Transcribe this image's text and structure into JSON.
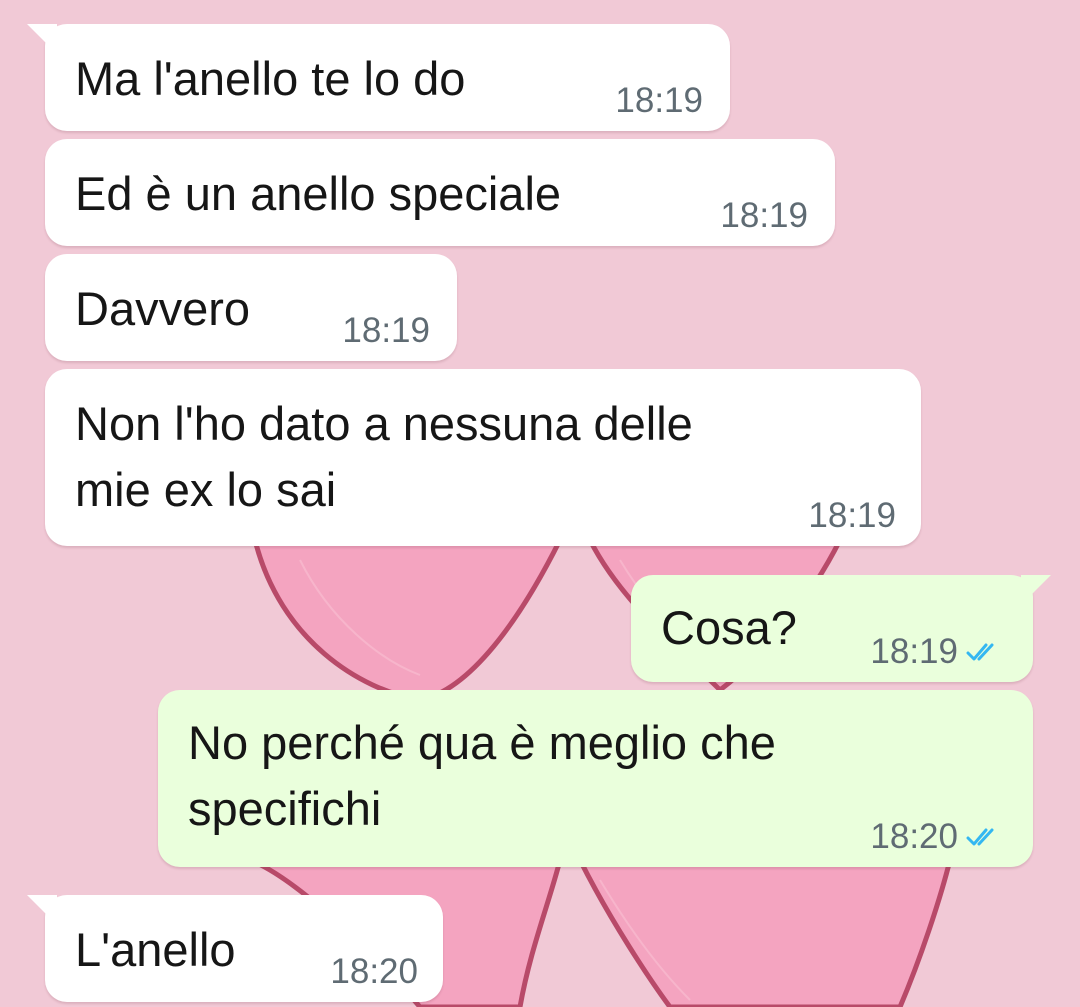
{
  "wallpaper": {
    "background": "#f1c9d6",
    "heart_color": "#f4a4c0",
    "heart_shadow": "#b84a69"
  },
  "messages": [
    {
      "direction": "incoming",
      "lines": [
        "Ma l'anello te lo do"
      ],
      "time": "18:19"
    },
    {
      "direction": "incoming",
      "lines": [
        "Ed è un anello speciale"
      ],
      "time": "18:19"
    },
    {
      "direction": "incoming",
      "lines": [
        "Davvero"
      ],
      "time": "18:19"
    },
    {
      "direction": "incoming",
      "lines": [
        "Non l'ho dato a nessuna delle",
        "mie ex lo sai"
      ],
      "time": "18:19"
    },
    {
      "direction": "outgoing",
      "lines": [
        "Cosa?"
      ],
      "time": "18:19",
      "status_icon": "double-check-read-icon"
    },
    {
      "direction": "outgoing",
      "lines": [
        "No perché qua è meglio che",
        "specifichi"
      ],
      "time": "18:20",
      "status_icon": "double-check-read-icon"
    },
    {
      "direction": "incoming",
      "lines": [
        "L'anello"
      ],
      "time": "18:20"
    }
  ],
  "colors": {
    "incoming_bubble": "#ffffff",
    "outgoing_bubble": "#eaffdc",
    "text": "#161616",
    "time": "#5f6b73",
    "read_ticks": "#34b7f1"
  }
}
